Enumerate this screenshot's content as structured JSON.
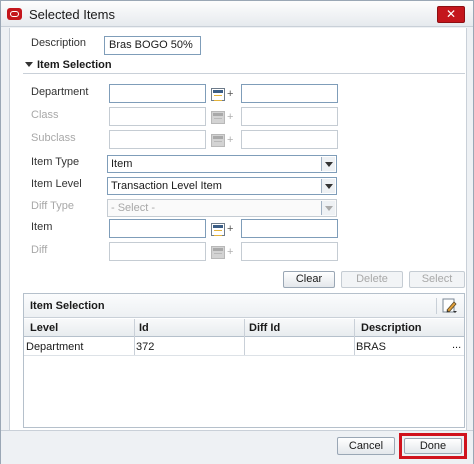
{
  "window": {
    "title": "Selected Items"
  },
  "description": {
    "label": "Description",
    "value": "Bras BOGO 50%"
  },
  "item_selection_section": {
    "header": "Item Selection"
  },
  "fields": {
    "department": {
      "label": "Department"
    },
    "class": {
      "label": "Class"
    },
    "subclass": {
      "label": "Subclass"
    },
    "item_type": {
      "label": "Item Type",
      "value": "Item"
    },
    "item_level": {
      "label": "Item Level",
      "value": "Transaction Level Item"
    },
    "diff_type": {
      "label": "Diff Type",
      "value": "- Select -"
    },
    "item": {
      "label": "Item"
    },
    "diff": {
      "label": "Diff"
    },
    "plus": "+"
  },
  "actions": {
    "clear": "Clear",
    "delete": "Delete",
    "select": "Select"
  },
  "table": {
    "title": "Item Selection",
    "columns": [
      "Level",
      "Id",
      "Diff Id",
      "Description"
    ],
    "rows": [
      {
        "level": "Department",
        "id": "372",
        "diff_id": "",
        "description": "BRAS",
        "more": "..."
      }
    ]
  },
  "footer": {
    "cancel": "Cancel",
    "done": "Done"
  },
  "colors": {
    "accent_red": "#c4161c",
    "highlight": "#d0121d",
    "input_border": "#7f9db9"
  },
  "icons": [
    "oracle-logo-icon",
    "close-icon",
    "lov-search-icon",
    "chevron-down-icon",
    "edit-pencil-icon"
  ]
}
